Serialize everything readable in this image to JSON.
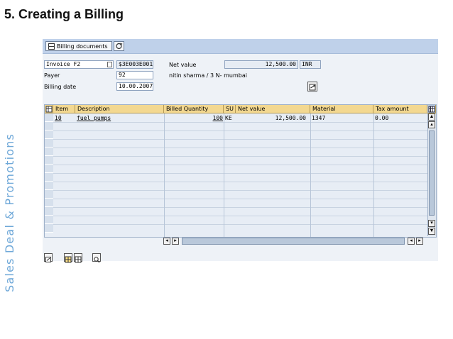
{
  "slide": {
    "title": "5. Creating a Billing",
    "side_label": "Sales Deal & Promotions"
  },
  "toolbar": {
    "billing_documents_label": "Billing documents",
    "billing_documents_icon": "table-icon",
    "refresh_icon": "refresh-icon"
  },
  "header": {
    "billing_type_value": "Invoice F2",
    "document_number": "$3E003E001",
    "net_value_label": "Net value",
    "net_value": "12,500.00",
    "currency": "INR",
    "payer_label": "Payer",
    "payer_value": "92",
    "payer_name": "nitin sharma / 3 N- mumbai",
    "billing_date_label": "Billing date",
    "billing_date_value": "10.00.2007",
    "detail_icon": "document-detail-icon"
  },
  "table": {
    "columns": [
      "Item",
      "Description",
      "Billed Quantity",
      "SU",
      "Net value",
      "Material",
      "Tax amount"
    ],
    "rows": [
      {
        "item": "10",
        "description": "fuel pumps",
        "billed_quantity": "100",
        "su": "KE",
        "net_value": "12,500.00",
        "material": "1347",
        "tax_amount": "0.00"
      }
    ],
    "empty_row_count": 13,
    "settings_icon": "table-settings-icon"
  },
  "bottom_toolbar": {
    "icons": [
      "details-icon",
      "select-all-icon",
      "deselect-icon",
      "find-icon"
    ]
  }
}
